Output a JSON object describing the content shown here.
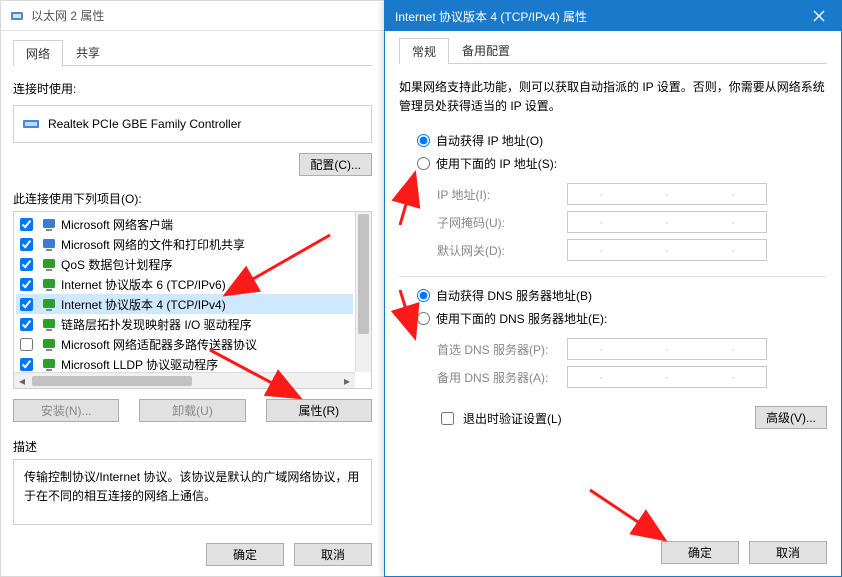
{
  "win1": {
    "title": "以太网 2 属性",
    "tabs": {
      "network": "网络",
      "share": "共享"
    },
    "connect_using_label": "连接时使用:",
    "adapter": "Realtek PCIe GBE Family Controller",
    "configure_btn": "配置(C)...",
    "items_label": "此连接使用下列项目(O):",
    "items": [
      {
        "checked": true,
        "iconColor": "#3a7bd5",
        "label": "Microsoft 网络客户端"
      },
      {
        "checked": true,
        "iconColor": "#3a7bd5",
        "label": "Microsoft 网络的文件和打印机共享"
      },
      {
        "checked": true,
        "iconColor": "#2ca02c",
        "label": "QoS 数据包计划程序"
      },
      {
        "checked": true,
        "iconColor": "#2ca02c",
        "label": "Internet 协议版本 6 (TCP/IPv6)"
      },
      {
        "checked": true,
        "iconColor": "#2ca02c",
        "label": "Internet 协议版本 4 (TCP/IPv4)",
        "selected": true
      },
      {
        "checked": true,
        "iconColor": "#2ca02c",
        "label": "链路层拓扑发现映射器 I/O 驱动程序"
      },
      {
        "checked": false,
        "iconColor": "#2ca02c",
        "label": "Microsoft 网络适配器多路传送器协议"
      },
      {
        "checked": true,
        "iconColor": "#2ca02c",
        "label": "Microsoft LLDP 协议驱动程序"
      }
    ],
    "install_btn": "安装(N)...",
    "uninstall_btn": "卸载(U)",
    "properties_btn": "属性(R)",
    "desc_label": "描述",
    "desc_text": "传输控制协议/Internet 协议。该协议是默认的广域网络协议，用于在不同的相互连接的网络上通信。",
    "ok_btn": "确定",
    "cancel_btn": "取消"
  },
  "win2": {
    "title": "Internet 协议版本 4 (TCP/IPv4) 属性",
    "tabs": {
      "general": "常规",
      "alt": "备用配置"
    },
    "info": "如果网络支持此功能，则可以获取自动指派的 IP 设置。否则，你需要从网络系统管理员处获得适当的 IP 设置。",
    "ip_auto": "自动获得 IP 地址(O)",
    "ip_manual": "使用下面的 IP 地址(S):",
    "ip_addr_label": "IP 地址(I):",
    "subnet_label": "子网掩码(U):",
    "gateway_label": "默认网关(D):",
    "dns_auto": "自动获得 DNS 服务器地址(B)",
    "dns_manual": "使用下面的 DNS 服务器地址(E):",
    "dns1_label": "首选 DNS 服务器(P):",
    "dns2_label": "备用 DNS 服务器(A):",
    "validate_label": "退出时验证设置(L)",
    "advanced_btn": "高级(V)...",
    "ok_btn": "确定",
    "cancel_btn": "取消"
  }
}
